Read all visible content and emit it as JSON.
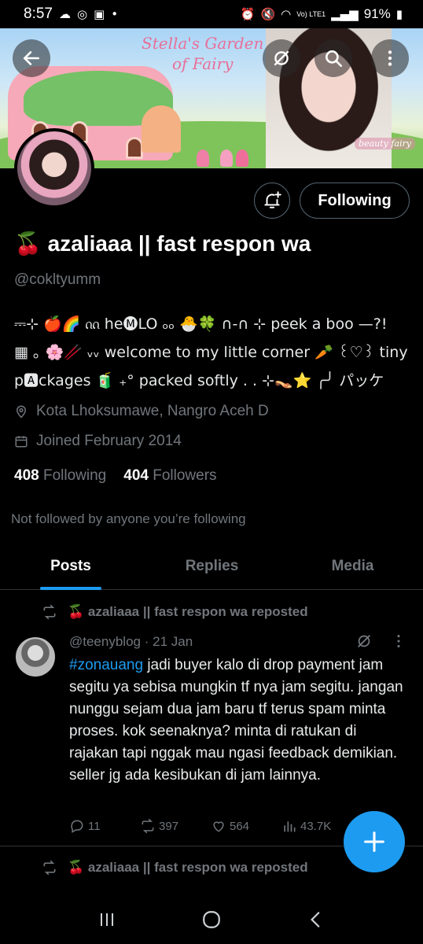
{
  "status_bar": {
    "time": "8:57",
    "left_icons": [
      "cloud-icon",
      "whatsapp-icon",
      "gallery-icon",
      "dot-icon"
    ],
    "battery": "91%",
    "network": "Vo) LTE1"
  },
  "banner": {
    "title_line1": "Stella's Garden",
    "title_line2": "of Fairy",
    "tag": "beauty fairy"
  },
  "profile": {
    "display_name": "🍒 azaliaaa || fast respon wa",
    "handle": "@cokltyumm",
    "bio_line1": "⎓⊹ 🍎🌈 ᦶ he🅜LO ₒₒ 🐣🍀 ∩-∩ ⊹ peek a boo —?!",
    "bio_line2": "▦ ｡ 🌸🥢 ᵥᵥ welcome to my little corner 🥕 ꒰♡꒱ tiny",
    "bio_line3": "p🅰ckages 🧃 ₊° packed softly . . ⊹👡⭐ ╭╯ パッケ",
    "location": "Kota Lhoksumawe, Nangro Aceh D",
    "joined": "Joined February 2014",
    "following_count": "408",
    "following_label": "Following",
    "followers_count": "404",
    "followers_label": "Followers",
    "not_followed": "Not followed by anyone you’re following",
    "following_button": "Following"
  },
  "tabs": [
    {
      "label": "Posts",
      "active": true
    },
    {
      "label": "Replies",
      "active": false
    },
    {
      "label": "Media",
      "active": false
    }
  ],
  "posts": [
    {
      "repost_label": "🍒 azaliaaa || fast respon wa reposted",
      "author_handle": "@teenyblog",
      "date": "· 21 Jan",
      "hashtag": "#zonauang",
      "text": " jadi buyer kalo di drop payment jam segitu ya sebisa mungkin tf nya jam segitu. jangan nunggu sejam dua jam baru tf terus spam minta proses. kok seenaknya? minta di ratukan di rajakan tapi nggak mau ngasi feedback demikian. seller jg ada kesibukan di jam lainnya.",
      "replies": "11",
      "reposts": "397",
      "likes": "564",
      "views": "43.7K"
    },
    {
      "repost_label": "🍒 azaliaaa || fast respon wa reposted"
    }
  ],
  "colors": {
    "accent": "#1d9bf0",
    "background": "#000000",
    "muted": "#71767b"
  }
}
